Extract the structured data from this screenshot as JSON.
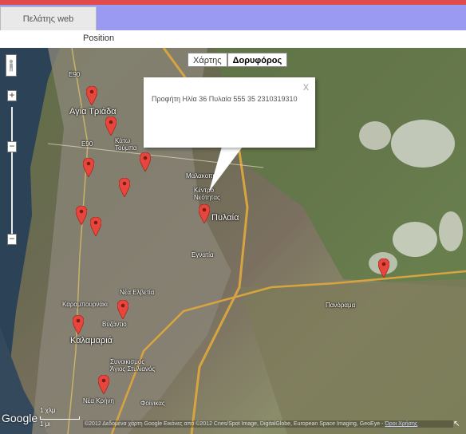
{
  "tab": {
    "label": "Πελάτης web"
  },
  "position_label": "Position",
  "map": {
    "type_buttons": [
      {
        "label": "Χάρτης",
        "active": false
      },
      {
        "label": "Δορυφόρος",
        "active": true
      }
    ],
    "zoom_in": "+",
    "zoom_out": "−",
    "zoom_step": "−",
    "infowindow": {
      "text": "Προφήτη Ηλία 36 Πυλαία 555 35 2310319310",
      "close": "x"
    },
    "labels": {
      "agia_triada": "Αγία Τριάδα",
      "katw_toumpa": "Κάτω Τούμπα",
      "malakopi": "Μαλακοπή",
      "kentro_neotitas": "Κέντρο Νεότητας",
      "pylaia": "Πυλαία",
      "nea_elvetia": "Νέα Ελβετία",
      "karampournaki": "Καραμπουρνάκι",
      "vyzantio": "Βυζάντιο",
      "kalamaria": "Καλαμαριά",
      "synoikismos": "Συνοικισμός Άγιος Στυλιανός",
      "nea_krini": "Νέα Κρήνη",
      "foinikas": "Φοίνικας",
      "panorama": "Πανόραμα",
      "e90": "E90",
      "egnatia": "Εγνατία"
    },
    "google_logo": "Google",
    "scale": {
      "upper": "1 χλμ",
      "lower": "1 μι"
    },
    "attribution": "©2012 Δεδομένα χάρτη Google Εικόνες από ©2012 Cnes/Spot Image, DigitalGlobe, European Space Imaging, GeoEye - ",
    "terms": "Όροι Χρήσης"
  },
  "colors": {
    "top_accent": "#e04a4a",
    "tab_bar": "#9a9af2",
    "marker": "#e8453c"
  }
}
